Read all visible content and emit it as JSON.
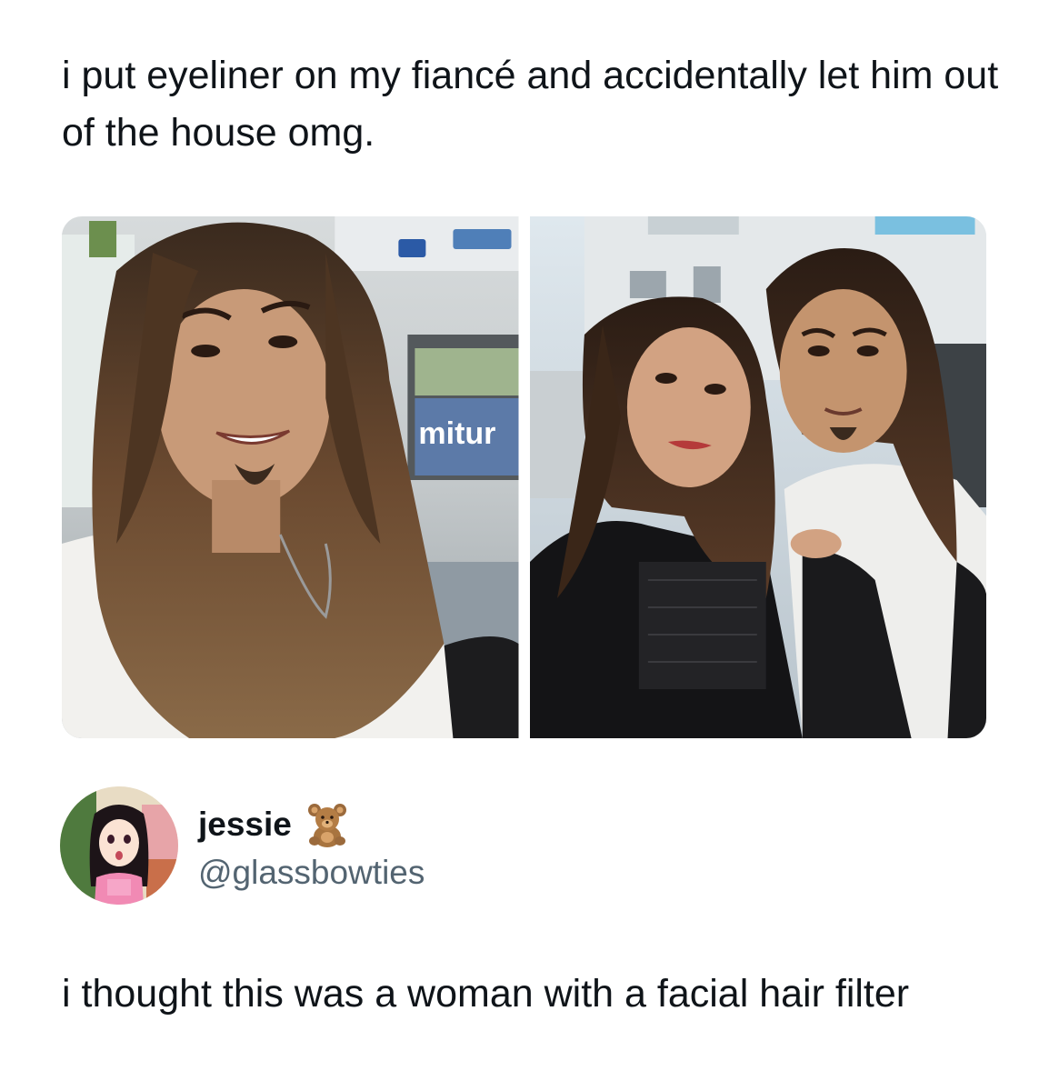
{
  "quoted_post": {
    "text": "i put eyeliner on my fiancé and accidentally let him out of the house omg.",
    "photo_left": {
      "sign_text": "mitur"
    },
    "photo_right": {}
  },
  "reply": {
    "author": {
      "display_name": "jessie",
      "name_emoji": "teddy-bear",
      "handle": "@glassbowties"
    },
    "text": "i thought this was a woman with a facial hair filter"
  },
  "colors": {
    "text_primary": "#0f1419",
    "text_secondary": "#536471",
    "background": "#ffffff"
  }
}
